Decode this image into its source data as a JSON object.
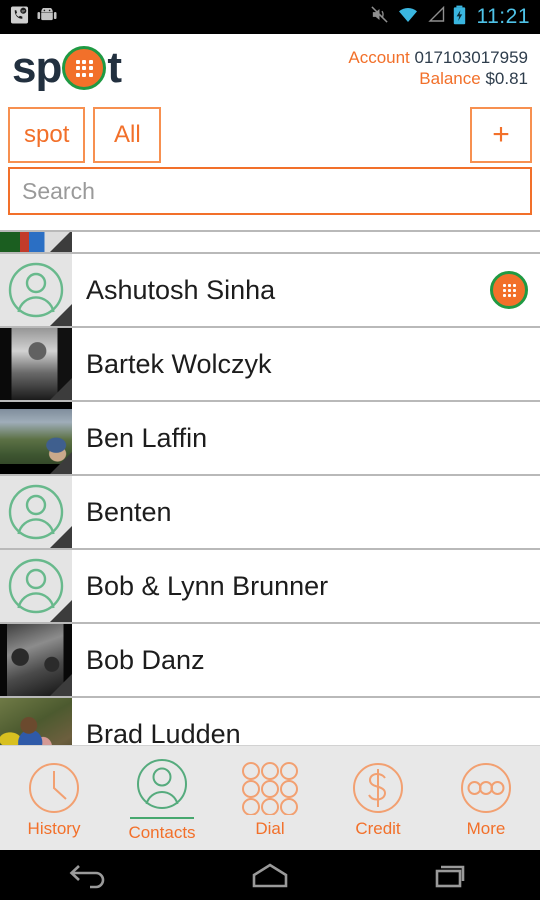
{
  "status_bar": {
    "time": "11:21",
    "left_icons": [
      "voip-phone-icon",
      "android-robot-icon"
    ],
    "right_icons": [
      "mute-icon",
      "wifi-icon",
      "cell-signal-icon",
      "battery-charging-icon"
    ],
    "accent_color": "#4fc3e8"
  },
  "header": {
    "logo_part1": "sp",
    "logo_part2": "t",
    "account_label": "Account",
    "account_value": "017103017959",
    "balance_label": "Balance",
    "balance_value": "$0.81",
    "brand_orange": "#f2702a",
    "brand_green": "#1f9a43",
    "logo_navy": "#22303f"
  },
  "filters": {
    "spot_label": "spot",
    "all_label": "All",
    "add_label": "+"
  },
  "search": {
    "placeholder": "Search",
    "value": ""
  },
  "contacts": [
    {
      "name": "",
      "avatar": "photo-clipped",
      "badge": false,
      "clipped": true
    },
    {
      "name": "Ashutosh Sinha",
      "avatar": "placeholder-person",
      "badge": true,
      "clipped": false
    },
    {
      "name": "Bartek Wolczyk",
      "avatar": "photo-bw-portrait",
      "badge": false,
      "clipped": false
    },
    {
      "name": "Ben Laffin",
      "avatar": "photo-mountain",
      "badge": false,
      "clipped": false
    },
    {
      "name": "Benten",
      "avatar": "placeholder-person",
      "badge": false,
      "clipped": false
    },
    {
      "name": "Bob & Lynn Brunner",
      "avatar": "placeholder-person",
      "badge": false,
      "clipped": false
    },
    {
      "name": "Bob Danz",
      "avatar": "photo-bw-couple",
      "badge": false,
      "clipped": false
    },
    {
      "name": "Brad Ludden",
      "avatar": "photo-outdoor",
      "badge": false,
      "clipped": false
    }
  ],
  "tabs": [
    {
      "label": "History",
      "icon": "clock-icon",
      "active": false
    },
    {
      "label": "Contacts",
      "icon": "person-icon",
      "active": true
    },
    {
      "label": "Dial",
      "icon": "keypad-icon",
      "active": false
    },
    {
      "label": "Credit",
      "icon": "dollar-icon",
      "active": false
    },
    {
      "label": "More",
      "icon": "ellipsis-icon",
      "active": false
    }
  ],
  "nav_bar": {
    "back": "back-icon",
    "home": "home-icon",
    "recents": "recents-icon"
  }
}
